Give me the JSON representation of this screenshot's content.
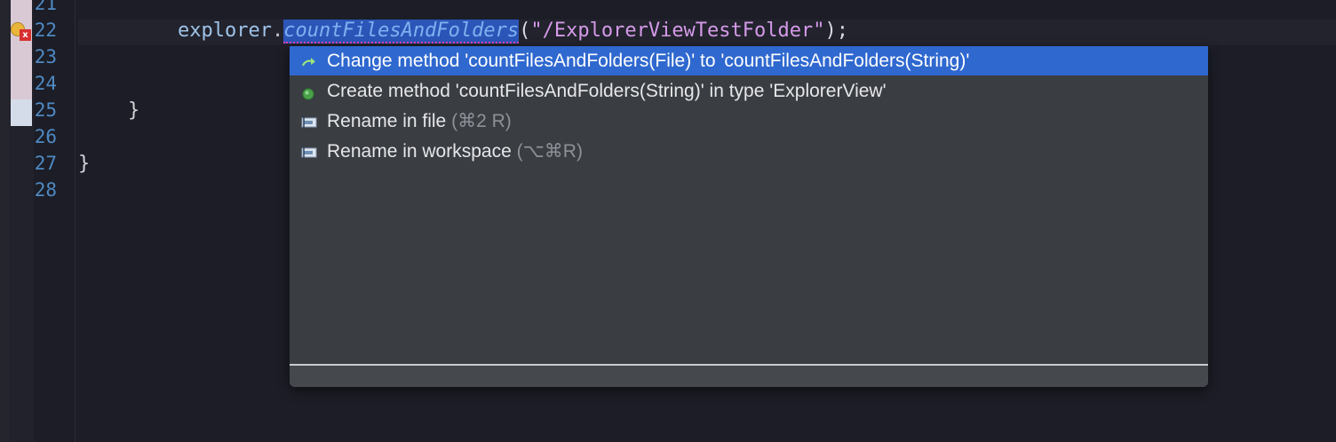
{
  "editor": {
    "line_numbers": [
      "21",
      "22",
      "23",
      "24",
      "25",
      "26",
      "27",
      "28"
    ],
    "code": {
      "receiver": "explorer",
      "dot": ".",
      "method": "countFilesAndFolders",
      "open_paren": "(",
      "argument": "\"/ExplorerViewTestFolder\"",
      "close": ");",
      "inner_brace": "}",
      "outer_brace": "}"
    },
    "error_marker_glyph": "x",
    "colors": {
      "background": "#1c1d26",
      "line_number": "#4f89c2",
      "string": "#d59ae8",
      "method_highlight": "#2c55b8",
      "error_underline": "#e040c0"
    }
  },
  "quick_fix": {
    "proposals": [
      {
        "label": "Change method 'countFilesAndFolders(File)' to 'countFilesAndFolders(String)'",
        "shortcut": "",
        "icon": "change-method-icon",
        "selected": true
      },
      {
        "label": "Create method 'countFilesAndFolders(String)' in type 'ExplorerView'",
        "shortcut": "",
        "icon": "create-method-icon",
        "selected": false
      },
      {
        "label": "Rename in file",
        "shortcut": "(⌘2 R)",
        "icon": "rename-icon",
        "selected": false
      },
      {
        "label": "Rename in workspace",
        "shortcut": "(⌥⌘R)",
        "icon": "rename-icon",
        "selected": false
      }
    ],
    "colors": {
      "selection": "#2f68cf",
      "background": "#3a3d42"
    }
  }
}
